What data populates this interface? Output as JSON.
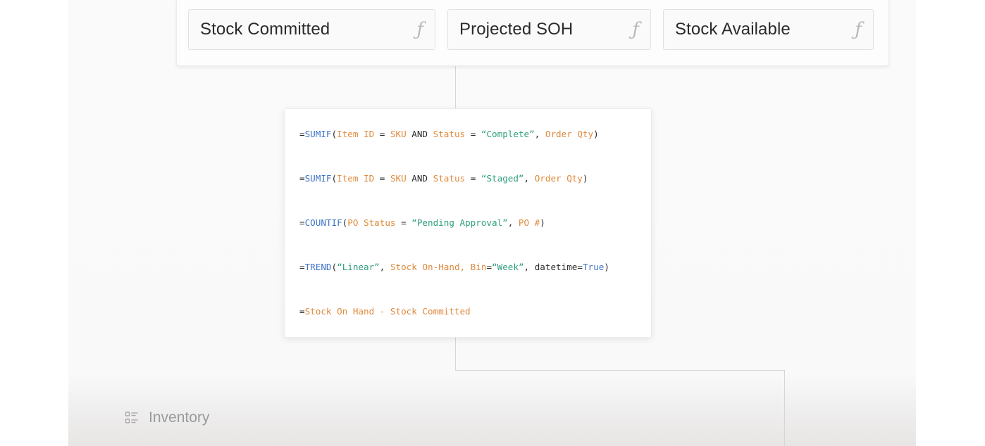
{
  "fields": [
    {
      "label": "Stock Committed",
      "icon": "function-icon",
      "glyph": "ƒ"
    },
    {
      "label": "Projected SOH",
      "icon": "function-icon",
      "glyph": "ƒ"
    },
    {
      "label": "Stock Available",
      "icon": "function-icon",
      "glyph": "ƒ"
    }
  ],
  "formulas": [
    [
      {
        "t": "op",
        "v": "="
      },
      {
        "t": "fn",
        "v": "SUMIF"
      },
      {
        "t": "op",
        "v": "("
      },
      {
        "t": "field",
        "v": "Item ID"
      },
      {
        "t": "op",
        "v": " = "
      },
      {
        "t": "field",
        "v": "SKU"
      },
      {
        "t": "kw",
        "v": " AND "
      },
      {
        "t": "field",
        "v": "Status"
      },
      {
        "t": "op",
        "v": " = "
      },
      {
        "t": "str",
        "v": "“Complete”"
      },
      {
        "t": "op",
        "v": ", "
      },
      {
        "t": "field",
        "v": "Order Qty"
      },
      {
        "t": "op",
        "v": ")"
      }
    ],
    [
      {
        "t": "op",
        "v": "="
      },
      {
        "t": "fn",
        "v": "SUMIF"
      },
      {
        "t": "op",
        "v": "("
      },
      {
        "t": "field",
        "v": "Item ID"
      },
      {
        "t": "op",
        "v": " = "
      },
      {
        "t": "field",
        "v": "SKU"
      },
      {
        "t": "kw",
        "v": " AND "
      },
      {
        "t": "field",
        "v": "Status"
      },
      {
        "t": "op",
        "v": " = "
      },
      {
        "t": "str",
        "v": "“Staged”"
      },
      {
        "t": "op",
        "v": ", "
      },
      {
        "t": "field",
        "v": "Order Qty"
      },
      {
        "t": "op",
        "v": ")"
      }
    ],
    [
      {
        "t": "op",
        "v": "="
      },
      {
        "t": "fn",
        "v": "COUNTIF"
      },
      {
        "t": "op",
        "v": "("
      },
      {
        "t": "field",
        "v": "PO Status"
      },
      {
        "t": "op",
        "v": " = "
      },
      {
        "t": "str",
        "v": "“Pending Approval”"
      },
      {
        "t": "op",
        "v": ", "
      },
      {
        "t": "field",
        "v": "PO #"
      },
      {
        "t": "op",
        "v": ")"
      }
    ],
    [
      {
        "t": "op",
        "v": "="
      },
      {
        "t": "fn",
        "v": "TREND"
      },
      {
        "t": "op",
        "v": "("
      },
      {
        "t": "str",
        "v": "“Linear”"
      },
      {
        "t": "op",
        "v": ", "
      },
      {
        "t": "field",
        "v": "Stock On-Hand, Bin"
      },
      {
        "t": "op",
        "v": "="
      },
      {
        "t": "str",
        "v": "“Week”"
      },
      {
        "t": "op",
        "v": ", "
      },
      {
        "t": "kw",
        "v": "datetime"
      },
      {
        "t": "op",
        "v": "="
      },
      {
        "t": "bool",
        "v": "True"
      },
      {
        "t": "op",
        "v": ")"
      }
    ],
    [
      {
        "t": "op",
        "v": "="
      },
      {
        "t": "field",
        "v": "Stock On Hand - Stock Committed"
      }
    ]
  ],
  "footer": {
    "label": "Inventory",
    "icon": "list-icon"
  },
  "colors": {
    "function": "#3d73c6",
    "field": "#e08a3c",
    "string": "#2f9e7e",
    "text": "#2b2b2b",
    "muted": "#9a9a9a"
  }
}
